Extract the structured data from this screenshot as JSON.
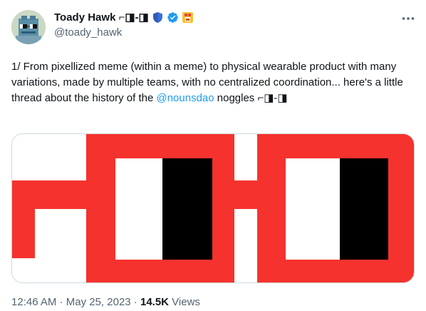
{
  "author": {
    "display_name": "Toady Hawk ⌐◨-◨",
    "handle": "@toady_hawk"
  },
  "tweet": {
    "text_before_mention": "1/ From pixellized meme (within a meme) to physical wearable product with many variations, made by multiple teams, with no centralized coordination... here's a little thread about the history of the ",
    "mention": "@nounsdao",
    "text_after_mention": " noggles ⌐◨-◨"
  },
  "meta": {
    "time": "12:46 AM",
    "separator": " · ",
    "date": "May 25, 2023",
    "separator2": " · ",
    "views_count": "14.5K",
    "views_label": " Views"
  },
  "colors": {
    "noggles_red": "#f5322d",
    "verified_blue": "#1d9bf0",
    "link_blue": "#1d9bf0"
  },
  "icons": [
    "shield-icon",
    "verified-badge-icon",
    "emoji-badge-icon",
    "more-options-icon"
  ]
}
